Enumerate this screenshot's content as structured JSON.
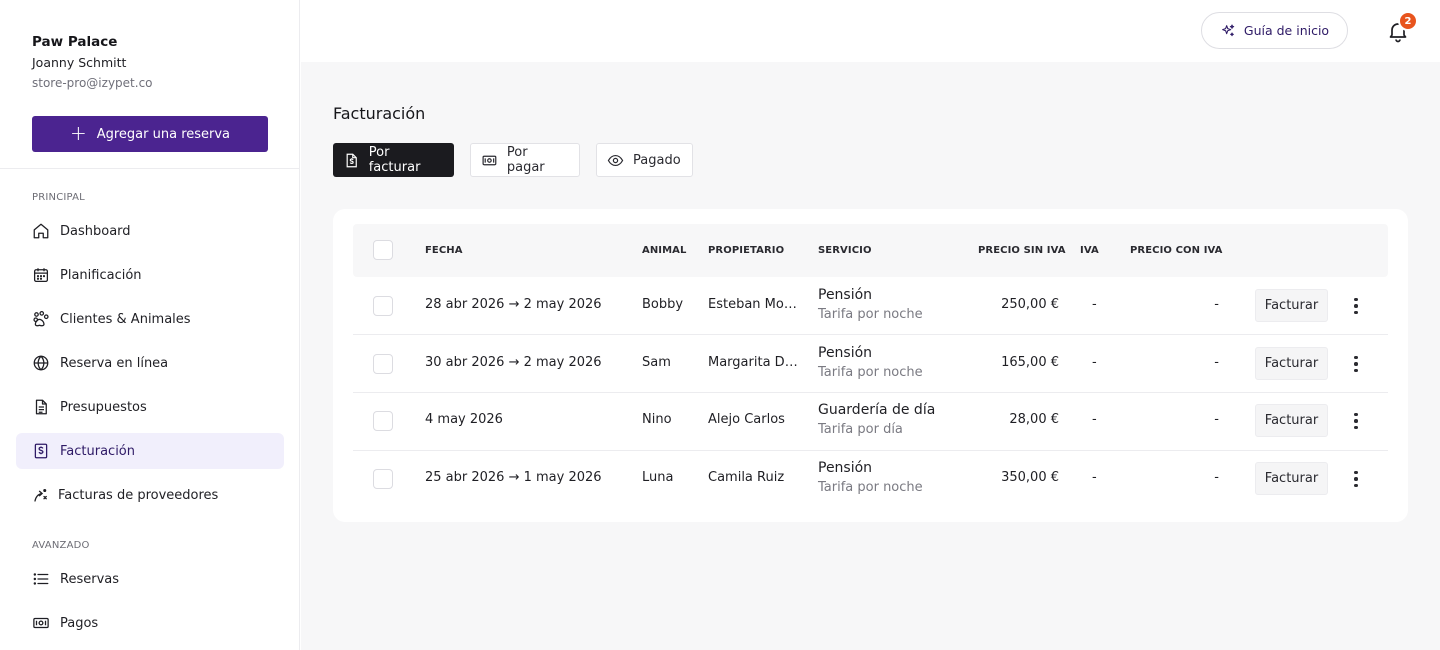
{
  "sidebar": {
    "store_name": "Paw Palace",
    "user_name": "Joanny Schmitt",
    "user_email": "store-pro@izypet.co",
    "add_button": "Agregar una reserva",
    "section_principal": "PRINCIPAL",
    "section_advanced": "AVANZADO",
    "items": [
      {
        "label": "Dashboard",
        "icon": "home-icon"
      },
      {
        "label": "Planificación",
        "icon": "calendar-icon"
      },
      {
        "label": "Clientes & Animales",
        "icon": "paw-icon"
      },
      {
        "label": "Reserva en línea",
        "icon": "globe-icon"
      },
      {
        "label": "Presupuestos",
        "icon": "document-icon"
      },
      {
        "label": "Facturación",
        "icon": "invoice-icon",
        "active": true
      },
      {
        "label": "Facturas de proveedores",
        "icon": "supplier-icon"
      },
      {
        "label": "Reservas",
        "icon": "list-icon"
      },
      {
        "label": "Pagos",
        "icon": "money-icon"
      }
    ]
  },
  "topbar": {
    "guide_label": "Guía de inicio",
    "notification_count": "2"
  },
  "main": {
    "title": "Facturación",
    "tabs": [
      {
        "label": "Por facturar",
        "active": true
      },
      {
        "label": "Por pagar"
      },
      {
        "label": "Pagado"
      }
    ]
  },
  "table": {
    "headers": {
      "date": "FECHA",
      "animal": "ANIMAL",
      "owner": "PROPIETARIO",
      "service": "SERVICIO",
      "price_no_tax": "PRECIO SIN IVA",
      "tax": "IVA",
      "price_with_tax": "PRECIO CON IVA"
    },
    "action_label": "Facturar",
    "rows": [
      {
        "date": "28 abr 2026 → 2 may 2026",
        "animal": "Bobby",
        "owner": "Esteban Mor…",
        "service": "Pensión",
        "rate": "Tarifa por noche",
        "price": "250,00 €",
        "tax": "-",
        "total": "-"
      },
      {
        "date": "30 abr 2026 → 2 may 2026",
        "animal": "Sam",
        "owner": "Margarita Dí…",
        "service": "Pensión",
        "rate": "Tarifa por noche",
        "price": "165,00 €",
        "tax": "-",
        "total": "-"
      },
      {
        "date": "4 may 2026",
        "animal": "Nino",
        "owner": "Alejo Carlos",
        "service": "Guardería de día",
        "rate": "Tarifa por día",
        "price": "28,00 €",
        "tax": "-",
        "total": "-"
      },
      {
        "date": "25 abr 2026 → 1 may 2026",
        "animal": "Luna",
        "owner": "Camila Ruiz",
        "service": "Pensión",
        "rate": "Tarifa por noche",
        "price": "350,00 €",
        "tax": "-",
        "total": "-"
      }
    ]
  },
  "colors": {
    "brand": "#4b2490",
    "active_nav_bg": "#f1effc",
    "badge": "#e8541d",
    "tab_dark": "#1b1b1f"
  }
}
